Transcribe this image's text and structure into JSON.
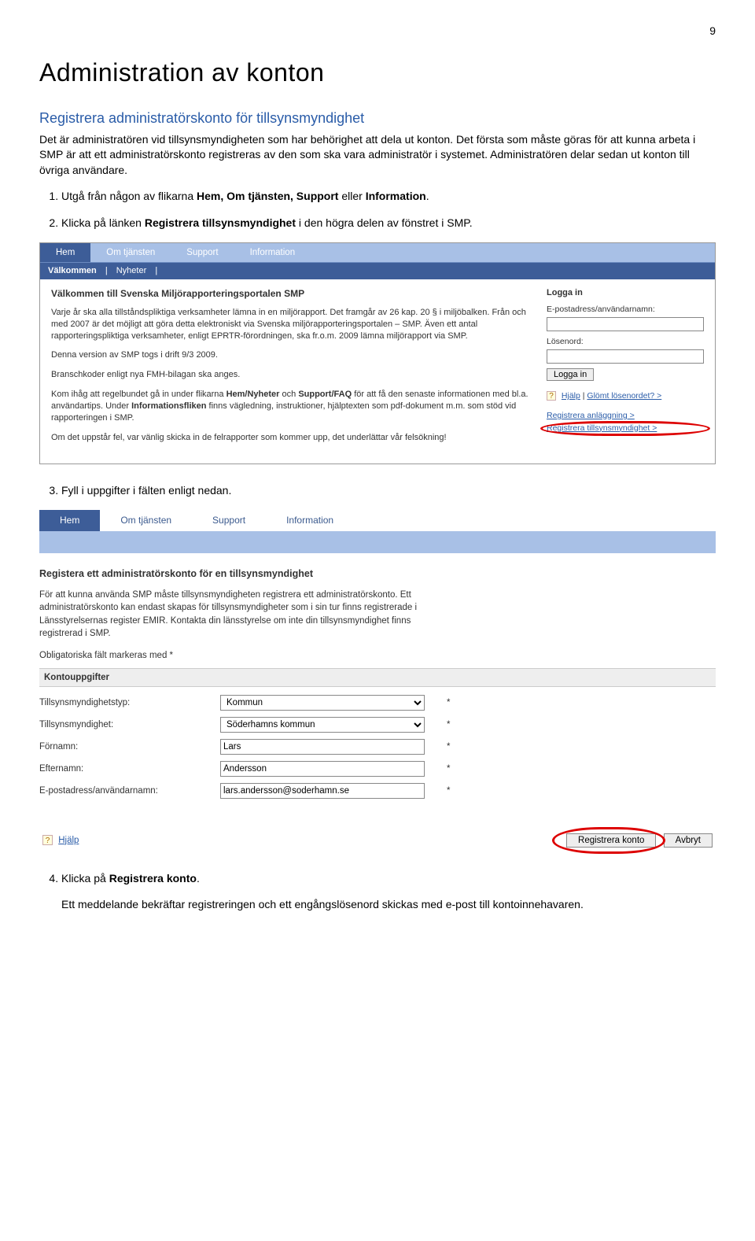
{
  "page_number": "9",
  "heading": "Administration av konton",
  "subheading": "Registrera administratörskonto för tillsynsmyndighet",
  "intro": "Det är administratören vid tillsynsmyndigheten som har behörighet att dela ut konton. Det första som måste göras för att kunna arbeta i SMP är att ett administratörskonto registreras av den som ska vara administratör i systemet. Administratören delar sedan ut konton till övriga användare.",
  "steps": {
    "s1_prefix": "Utgå från någon av flikarna ",
    "s1_bold": "Hem, Om tjänsten, Support",
    "s1_mid": " eller ",
    "s1_bold2": "Information",
    "s1_suffix": ".",
    "s2_prefix": "Klicka på länken ",
    "s2_bold": "Registrera tillsynsmyndighet",
    "s2_suffix": " i den högra delen av fönstret i SMP.",
    "s3": "Fyll i uppgifter i fälten enligt nedan.",
    "s4_prefix": "Klicka på ",
    "s4_bold": "Registrera konto",
    "s4_suffix": "."
  },
  "closing": "Ett meddelande bekräftar registreringen och ett engångslösenord skickas med e-post till kontoinnehavaren.",
  "shot1": {
    "tabs": [
      "Hem",
      "Om tjänsten",
      "Support",
      "Information"
    ],
    "subtabs": [
      "Välkommen",
      "Nyheter"
    ],
    "welcome_title": "Välkommen till Svenska Miljörapporteringsportalen SMP",
    "p1": "Varje år ska alla tillståndspliktiga verksamheter lämna in en miljörapport. Det framgår av 26 kap. 20 § i miljöbalken. Från och med 2007 är det möjligt att göra detta elektroniskt via Svenska miljörapporteringsportalen – SMP. Även ett antal rapporteringspliktiga verksamheter, enligt EPRTR-förordningen, ska fr.o.m. 2009 lämna miljörapport via SMP.",
    "p2": "Denna version av SMP togs i drift 9/3 2009.",
    "p3": "Branschkoder enligt nya FMH-bilagan ska anges.",
    "p4_a": "Kom ihåg att regelbundet gå in under flikarna ",
    "p4_b": "Hem/Nyheter",
    "p4_c": " och ",
    "p4_d": "Support/FAQ",
    "p4_e": " för att få den senaste informationen med bl.a. användartips. Under ",
    "p4_f": "Informationsfliken",
    "p4_g": " finns vägledning, instruktioner, hjälptexten som pdf-dokument m.m. som stöd vid rapporteringen i SMP.",
    "p5": "Om det uppstår fel, var vänlig skicka in de felrapporter som kommer upp, det underlättar vår felsökning!",
    "login_title": "Logga in",
    "login_user_label": "E-postadress/användarnamn:",
    "login_pass_label": "Lösenord:",
    "login_button": "Logga in",
    "help_label": "Hjälp",
    "lost_pw": "Glömt lösenordet? >",
    "reg_anl": "Registrera anläggning >",
    "reg_tsm": "Registrera tillsynsmyndighet >"
  },
  "shot2": {
    "tabs": [
      "Hem",
      "Om tjänsten",
      "Support",
      "Information"
    ]
  },
  "shot3": {
    "title": "Registera ett administratörskonto för en tillsynsmyndighet",
    "intro": "För att kunna använda SMP måste tillsynsmyndigheten registrera ett administratörskonto. Ett administratörskonto kan endast skapas för tillsynsmyndigheter som i sin tur finns registrerade i Länsstyrelsernas register EMIR. Kontakta din länsstyrelse om inte din tillsynsmyndighet finns registrerad i SMP.",
    "oblig": "Obligatoriska fält markeras med *",
    "section": "Kontouppgifter",
    "rows": [
      {
        "label": "Tillsynsmyndighetstyp:",
        "value": "Kommun",
        "type": "select"
      },
      {
        "label": "Tillsynsmyndighet:",
        "value": "Söderhamns kommun",
        "type": "select"
      },
      {
        "label": "Förnamn:",
        "value": "Lars",
        "type": "text"
      },
      {
        "label": "Efternamn:",
        "value": "Andersson",
        "type": "text"
      },
      {
        "label": "E-postadress/användarnamn:",
        "value": "lars.andersson@soderhamn.se",
        "type": "text"
      }
    ],
    "help": "Hjälp",
    "btn_register": "Registrera konto",
    "btn_cancel": "Avbryt"
  }
}
